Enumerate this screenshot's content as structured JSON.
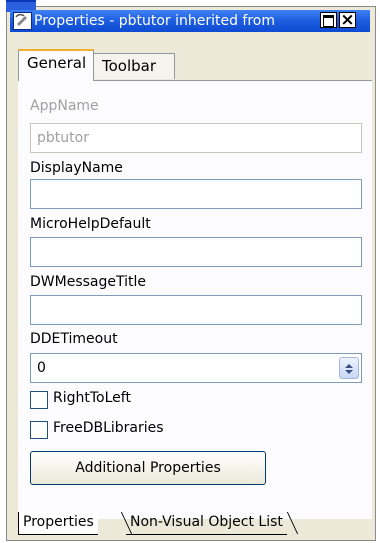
{
  "window": {
    "title": "Properties - pbtutor inherited from",
    "icon": "properties-window-icon",
    "controls": [
      "maximize-icon",
      "close-icon"
    ]
  },
  "tabs": [
    {
      "label": "General",
      "active": true
    },
    {
      "label": "Toolbar",
      "active": false
    }
  ],
  "fields": {
    "appname": {
      "label": "AppName",
      "value": "pbtutor",
      "enabled": false
    },
    "displayname": {
      "label": "DisplayName",
      "value": ""
    },
    "microhelp": {
      "label": "MicroHelpDefault",
      "value": ""
    },
    "dwmessage": {
      "label": "DWMessageTitle",
      "value": ""
    },
    "ddetimeout": {
      "label": "DDETimeout",
      "value": "0"
    }
  },
  "checkboxes": {
    "righttoleft": {
      "label": "RightToLeft",
      "checked": false
    },
    "freedb": {
      "label": "FreeDBLibraries",
      "checked": false
    }
  },
  "buttons": {
    "additional": "Additional Properties"
  },
  "bottom_tabs": [
    {
      "label": "Properties",
      "active": true
    },
    {
      "label": "Non-Visual Object List",
      "active": false
    }
  ]
}
